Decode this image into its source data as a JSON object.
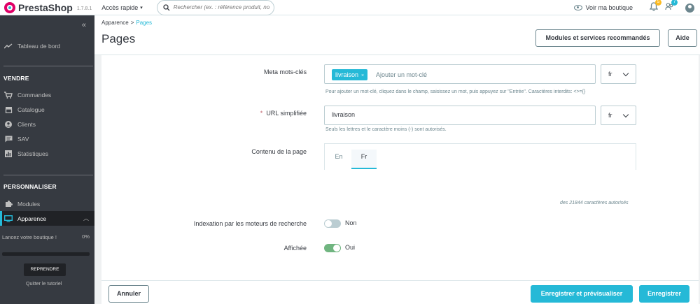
{
  "topbar": {
    "logo_text": "PrestaShop",
    "version": "1.7.8.1",
    "quick_access": "Accès rapide",
    "search_placeholder": "Rechercher (ex. : référence produit, no",
    "view_shop": "Voir ma boutique",
    "notifications_count": "5",
    "messages_count": "7"
  },
  "sidebar": {
    "dashboard": "Tableau de bord",
    "section_sell": "VENDRE",
    "sell_items": [
      "Commandes",
      "Catalogue",
      "Clients",
      "SAV",
      "Statistiques"
    ],
    "section_customize": "PERSONNALISER",
    "modules": "Modules",
    "appearance": "Apparence",
    "tuto_text": "Lancez votre boutique !",
    "tuto_progress": "0%",
    "tuto_progress_value": 0,
    "resume_button": "REPRENDRE",
    "quit_tutorial": "Quitter le tutoriel"
  },
  "header": {
    "breadcrumb_parent": "Apparence",
    "breadcrumb_current": "Pages",
    "title": "Pages",
    "recommended_button": "Modules et services recommandés",
    "help_button": "Aide"
  },
  "form": {
    "meta_keywords_label": "Meta mots-clés",
    "keyword_tag": "livraison",
    "keyword_placeholder": "Ajouter un mot-clé",
    "keyword_lang": "fr",
    "keyword_hint": "Pour ajouter un mot-clé, cliquez dans le champ, saisissez un mot, puis appuyez sur \"Entrée\". Caractères interdits: <>={}",
    "url_label": "URL simplifiée",
    "url_value": "livraison",
    "url_lang": "fr",
    "url_hint": "Seuls les lettres et le caractère moins (-) sont autorisés.",
    "content_label": "Contenu de la page",
    "tab_en": "En",
    "tab_fr": "Fr",
    "char_counter": "des 21844 caractères autorisés",
    "indexation_label": "Indexation par les moteurs de recherche",
    "indexation_value": "Non",
    "displayed_label": "Affichée",
    "displayed_value": "Oui"
  },
  "footer": {
    "cancel": "Annuler",
    "save_preview": "Enregistrer et prévisualiser",
    "save": "Enregistrer"
  },
  "colors": {
    "accent": "#25b9d7",
    "sidebar_bg": "#363a41",
    "toggle_on": "#70b580"
  }
}
